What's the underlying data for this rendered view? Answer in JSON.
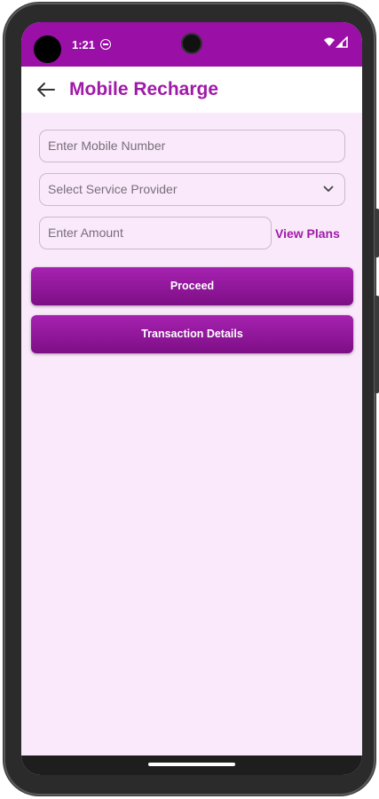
{
  "status_bar": {
    "time": "1:21",
    "background": "#9a0fa5",
    "icons": [
      "dnd-icon",
      "wifi-icon",
      "signal-icon"
    ]
  },
  "app_bar": {
    "title": "Mobile Recharge",
    "back_icon": "arrow-left-icon",
    "accent": "#a01aa8"
  },
  "form": {
    "mobile_placeholder": "Enter Mobile Number",
    "provider_placeholder": "Select Service Provider",
    "amount_placeholder": "Enter Amount",
    "view_plans_label": "View Plans"
  },
  "buttons": {
    "proceed_label": "Proceed",
    "transaction_details_label": "Transaction Details"
  },
  "colors": {
    "screen_background": "#f9e9fa",
    "button_gradient_top": "#a622b1",
    "button_gradient_bottom": "#7d0e86"
  }
}
